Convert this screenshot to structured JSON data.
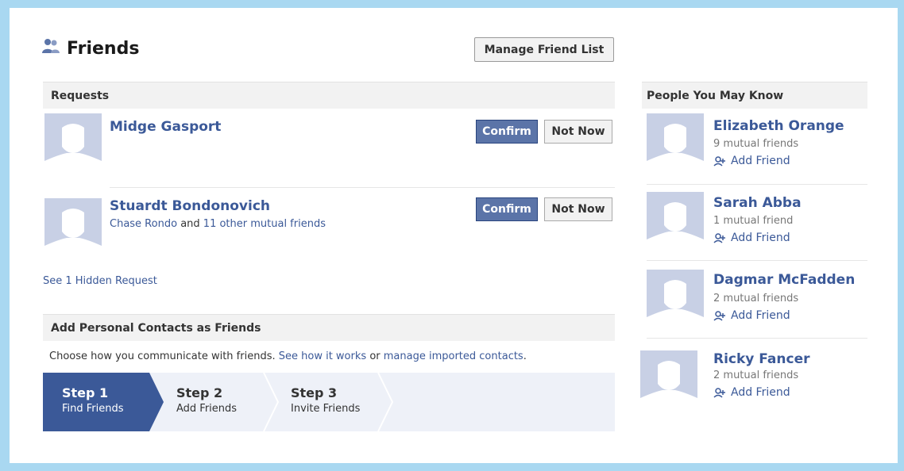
{
  "header": {
    "title": "Friends",
    "manage_button": "Manage Friend List"
  },
  "requests": {
    "heading": "Requests",
    "items": [
      {
        "name": "Midge Gasport",
        "confirm": "Confirm",
        "not_now": "Not Now"
      },
      {
        "name": "Stuardt Bondonovich",
        "mutual_link": "Chase Rondo",
        "mutual_and": "and",
        "mutual_other": "11 other mutual friends",
        "confirm": "Confirm",
        "not_now": "Not Now"
      }
    ],
    "hidden_link": "See 1 Hidden Request"
  },
  "contacts": {
    "heading": "Add Personal Contacts as Friends",
    "desc_prefix": "Choose how you communicate with friends.",
    "see_how": "See how it works",
    "or": "or",
    "manage_imported": "manage imported contacts",
    "period": ".",
    "steps": [
      {
        "label": "Step 1",
        "sub": "Find Friends"
      },
      {
        "label": "Step 2",
        "sub": "Add Friends"
      },
      {
        "label": "Step 3",
        "sub": "Invite Friends"
      }
    ]
  },
  "pymk": {
    "heading": "People You May Know",
    "items": [
      {
        "name": "Elizabeth Orange",
        "mutual": "9 mutual friends",
        "add": "Add Friend"
      },
      {
        "name": "Sarah Abba",
        "mutual": "1 mutual friend",
        "add": "Add Friend"
      },
      {
        "name": "Dagmar McFadden",
        "mutual": "2 mutual friends",
        "add": "Add Friend"
      },
      {
        "name": "Ricky Fancer",
        "mutual": "2 mutual friends",
        "add": "Add Friend"
      }
    ]
  },
  "colors": {
    "frame_border": "#a9d8f1",
    "link_blue": "#3b5998",
    "confirm_blue": "#5b74a8",
    "step_active": "#3b5998",
    "avatar_bg": "#c8d0e5"
  },
  "icons": {
    "title_icon": "friends-icon",
    "add_friend_icon": "add-friend-icon",
    "avatar_icon": "default-avatar-icon"
  }
}
